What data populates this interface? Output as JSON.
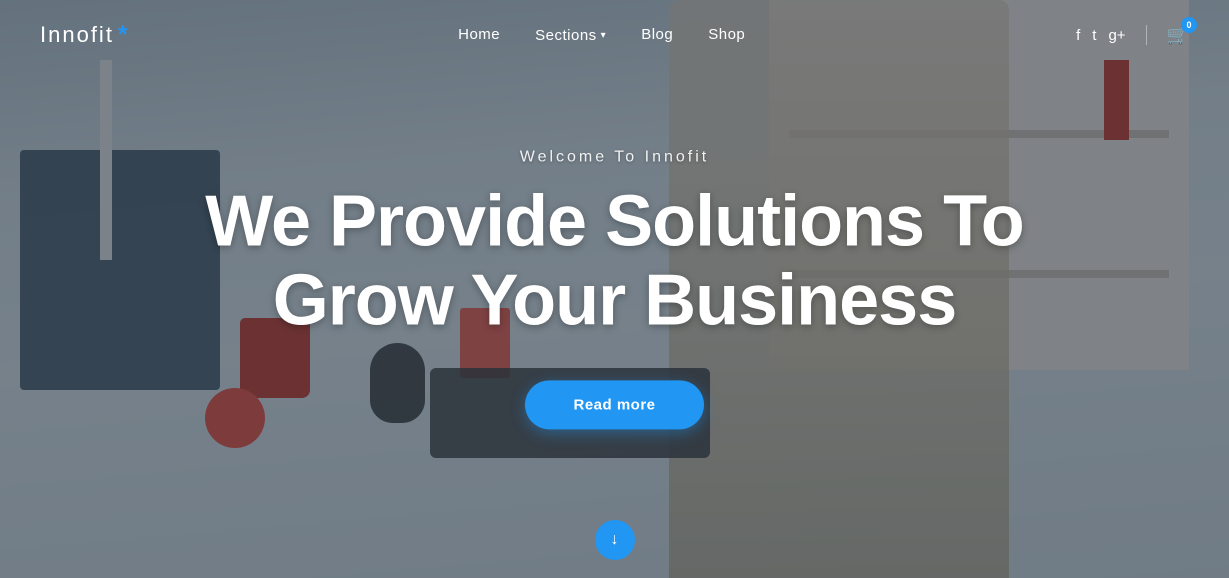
{
  "brand": {
    "name": "Innofit",
    "asterisk": "*"
  },
  "navbar": {
    "links": [
      {
        "label": "Home",
        "href": "#",
        "has_dropdown": false
      },
      {
        "label": "Sections",
        "href": "#",
        "has_dropdown": true
      },
      {
        "label": "Blog",
        "href": "#",
        "has_dropdown": false
      },
      {
        "label": "Shop",
        "href": "#",
        "has_dropdown": false
      }
    ],
    "social": [
      {
        "name": "facebook-icon",
        "glyph": "f"
      },
      {
        "name": "twitter-icon",
        "glyph": "t"
      },
      {
        "name": "google-plus-icon",
        "glyph": "g+"
      }
    ],
    "cart_count": "0"
  },
  "hero": {
    "subtitle": "Welcome To Innofit",
    "title_line1": "We Provide Solutions To",
    "title_line2": "Grow Your Business",
    "cta_label": "Read more"
  },
  "scroll_indicator": {
    "arrow": "↓"
  },
  "colors": {
    "accent": "#2196F3",
    "text_primary": "#ffffff",
    "overlay": "rgba(30,45,60,0.52)"
  }
}
